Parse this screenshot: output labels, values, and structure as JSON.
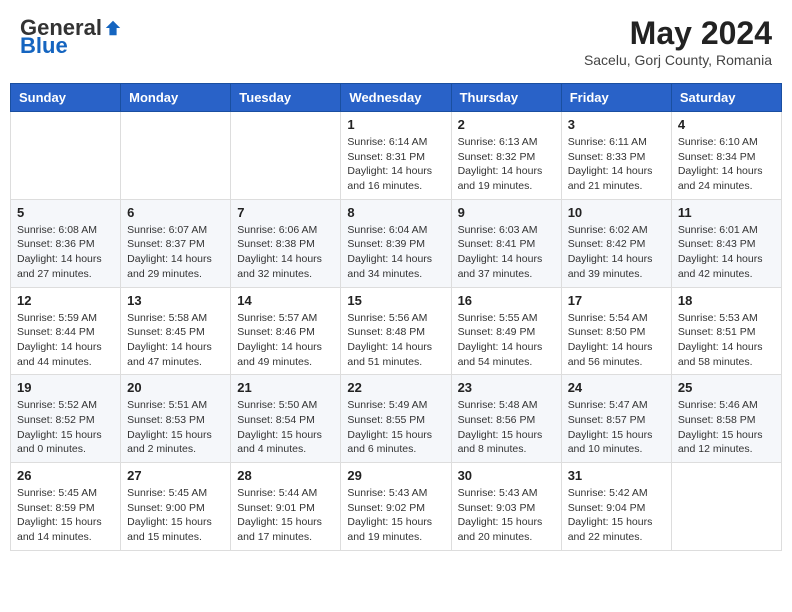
{
  "header": {
    "logo_general": "General",
    "logo_blue": "Blue",
    "month_title": "May 2024",
    "location": "Sacelu, Gorj County, Romania"
  },
  "calendar": {
    "days_of_week": [
      "Sunday",
      "Monday",
      "Tuesday",
      "Wednesday",
      "Thursday",
      "Friday",
      "Saturday"
    ],
    "weeks": [
      [
        {
          "day": "",
          "info": ""
        },
        {
          "day": "",
          "info": ""
        },
        {
          "day": "",
          "info": ""
        },
        {
          "day": "1",
          "info": "Sunrise: 6:14 AM\nSunset: 8:31 PM\nDaylight: 14 hours\nand 16 minutes."
        },
        {
          "day": "2",
          "info": "Sunrise: 6:13 AM\nSunset: 8:32 PM\nDaylight: 14 hours\nand 19 minutes."
        },
        {
          "day": "3",
          "info": "Sunrise: 6:11 AM\nSunset: 8:33 PM\nDaylight: 14 hours\nand 21 minutes."
        },
        {
          "day": "4",
          "info": "Sunrise: 6:10 AM\nSunset: 8:34 PM\nDaylight: 14 hours\nand 24 minutes."
        }
      ],
      [
        {
          "day": "5",
          "info": "Sunrise: 6:08 AM\nSunset: 8:36 PM\nDaylight: 14 hours\nand 27 minutes."
        },
        {
          "day": "6",
          "info": "Sunrise: 6:07 AM\nSunset: 8:37 PM\nDaylight: 14 hours\nand 29 minutes."
        },
        {
          "day": "7",
          "info": "Sunrise: 6:06 AM\nSunset: 8:38 PM\nDaylight: 14 hours\nand 32 minutes."
        },
        {
          "day": "8",
          "info": "Sunrise: 6:04 AM\nSunset: 8:39 PM\nDaylight: 14 hours\nand 34 minutes."
        },
        {
          "day": "9",
          "info": "Sunrise: 6:03 AM\nSunset: 8:41 PM\nDaylight: 14 hours\nand 37 minutes."
        },
        {
          "day": "10",
          "info": "Sunrise: 6:02 AM\nSunset: 8:42 PM\nDaylight: 14 hours\nand 39 minutes."
        },
        {
          "day": "11",
          "info": "Sunrise: 6:01 AM\nSunset: 8:43 PM\nDaylight: 14 hours\nand 42 minutes."
        }
      ],
      [
        {
          "day": "12",
          "info": "Sunrise: 5:59 AM\nSunset: 8:44 PM\nDaylight: 14 hours\nand 44 minutes."
        },
        {
          "day": "13",
          "info": "Sunrise: 5:58 AM\nSunset: 8:45 PM\nDaylight: 14 hours\nand 47 minutes."
        },
        {
          "day": "14",
          "info": "Sunrise: 5:57 AM\nSunset: 8:46 PM\nDaylight: 14 hours\nand 49 minutes."
        },
        {
          "day": "15",
          "info": "Sunrise: 5:56 AM\nSunset: 8:48 PM\nDaylight: 14 hours\nand 51 minutes."
        },
        {
          "day": "16",
          "info": "Sunrise: 5:55 AM\nSunset: 8:49 PM\nDaylight: 14 hours\nand 54 minutes."
        },
        {
          "day": "17",
          "info": "Sunrise: 5:54 AM\nSunset: 8:50 PM\nDaylight: 14 hours\nand 56 minutes."
        },
        {
          "day": "18",
          "info": "Sunrise: 5:53 AM\nSunset: 8:51 PM\nDaylight: 14 hours\nand 58 minutes."
        }
      ],
      [
        {
          "day": "19",
          "info": "Sunrise: 5:52 AM\nSunset: 8:52 PM\nDaylight: 15 hours\nand 0 minutes."
        },
        {
          "day": "20",
          "info": "Sunrise: 5:51 AM\nSunset: 8:53 PM\nDaylight: 15 hours\nand 2 minutes."
        },
        {
          "day": "21",
          "info": "Sunrise: 5:50 AM\nSunset: 8:54 PM\nDaylight: 15 hours\nand 4 minutes."
        },
        {
          "day": "22",
          "info": "Sunrise: 5:49 AM\nSunset: 8:55 PM\nDaylight: 15 hours\nand 6 minutes."
        },
        {
          "day": "23",
          "info": "Sunrise: 5:48 AM\nSunset: 8:56 PM\nDaylight: 15 hours\nand 8 minutes."
        },
        {
          "day": "24",
          "info": "Sunrise: 5:47 AM\nSunset: 8:57 PM\nDaylight: 15 hours\nand 10 minutes."
        },
        {
          "day": "25",
          "info": "Sunrise: 5:46 AM\nSunset: 8:58 PM\nDaylight: 15 hours\nand 12 minutes."
        }
      ],
      [
        {
          "day": "26",
          "info": "Sunrise: 5:45 AM\nSunset: 8:59 PM\nDaylight: 15 hours\nand 14 minutes."
        },
        {
          "day": "27",
          "info": "Sunrise: 5:45 AM\nSunset: 9:00 PM\nDaylight: 15 hours\nand 15 minutes."
        },
        {
          "day": "28",
          "info": "Sunrise: 5:44 AM\nSunset: 9:01 PM\nDaylight: 15 hours\nand 17 minutes."
        },
        {
          "day": "29",
          "info": "Sunrise: 5:43 AM\nSunset: 9:02 PM\nDaylight: 15 hours\nand 19 minutes."
        },
        {
          "day": "30",
          "info": "Sunrise: 5:43 AM\nSunset: 9:03 PM\nDaylight: 15 hours\nand 20 minutes."
        },
        {
          "day": "31",
          "info": "Sunrise: 5:42 AM\nSunset: 9:04 PM\nDaylight: 15 hours\nand 22 minutes."
        },
        {
          "day": "",
          "info": ""
        }
      ]
    ]
  }
}
